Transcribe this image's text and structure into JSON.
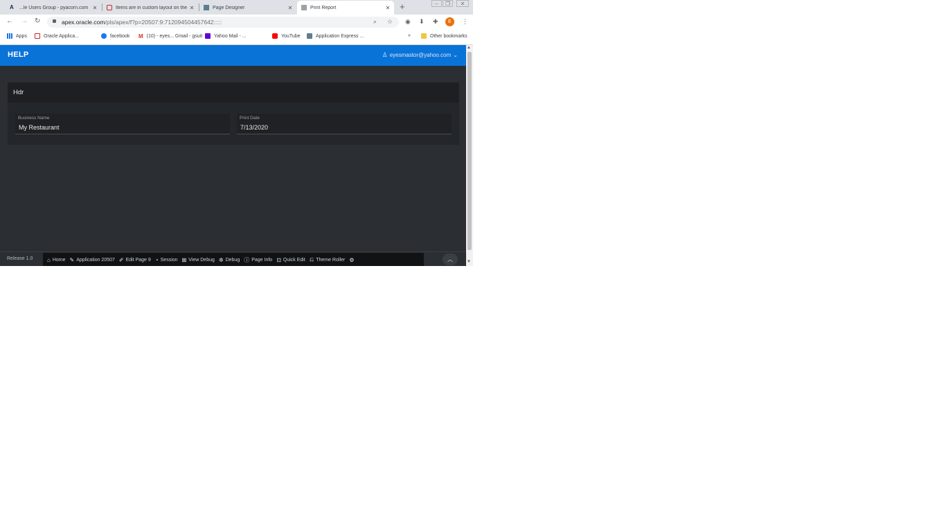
{
  "browser": {
    "tabs": [
      {
        "title": "...le Users Group - pyacorn.com"
      },
      {
        "title": "Items are in custom layout on the ..."
      },
      {
        "title": "Page Designer"
      },
      {
        "title": "Print Report"
      }
    ],
    "new_tab": "+",
    "url": {
      "host": "apex.oracle.com",
      "path": "/pls/apex/f?p=20507:9:712094504457642:::::"
    },
    "avatar_initial": "E",
    "bookmarks": [
      {
        "label": "Apps"
      },
      {
        "label": "Oracle Applica..."
      },
      {
        "label": "facebook"
      },
      {
        "label": "(10) - eyes... Gmail - gsuit"
      },
      {
        "label": "Yahoo Mail - ..."
      },
      {
        "label": "YouTube"
      },
      {
        "label": "Application Express ..."
      }
    ],
    "bookmarks_overflow": "»",
    "other_bookmarks": "Other bookmarks"
  },
  "app": {
    "title": "HELP",
    "user": "eyesmastor@yahoo.com"
  },
  "region": {
    "title": "Hdr",
    "fields": [
      {
        "label": "Business Name",
        "value": "My Restaurant"
      },
      {
        "label": "Print Date",
        "value": "7/13/2020"
      }
    ]
  },
  "footer": {
    "release": "Release 1.0",
    "dev_toolbar": [
      {
        "label": "Home",
        "icon": "home-icon"
      },
      {
        "label": "Application 20507",
        "icon": "edit-icon"
      },
      {
        "label": "Edit Page 9",
        "icon": "edit-page-icon"
      },
      {
        "label": "Session",
        "icon": "session-icon"
      },
      {
        "label": "View Debug",
        "icon": "view-debug-icon"
      },
      {
        "label": "Debug",
        "icon": "debug-icon"
      },
      {
        "label": "Page Info",
        "icon": "info-icon"
      },
      {
        "label": "Quick Edit",
        "icon": "quick-edit-icon"
      },
      {
        "label": "Theme Roller",
        "icon": "theme-roller-icon"
      }
    ]
  },
  "colors": {
    "header": "#0a73d8",
    "body": "#2b2e32",
    "region": "#23262a",
    "dev_toolbar": "#111214"
  }
}
